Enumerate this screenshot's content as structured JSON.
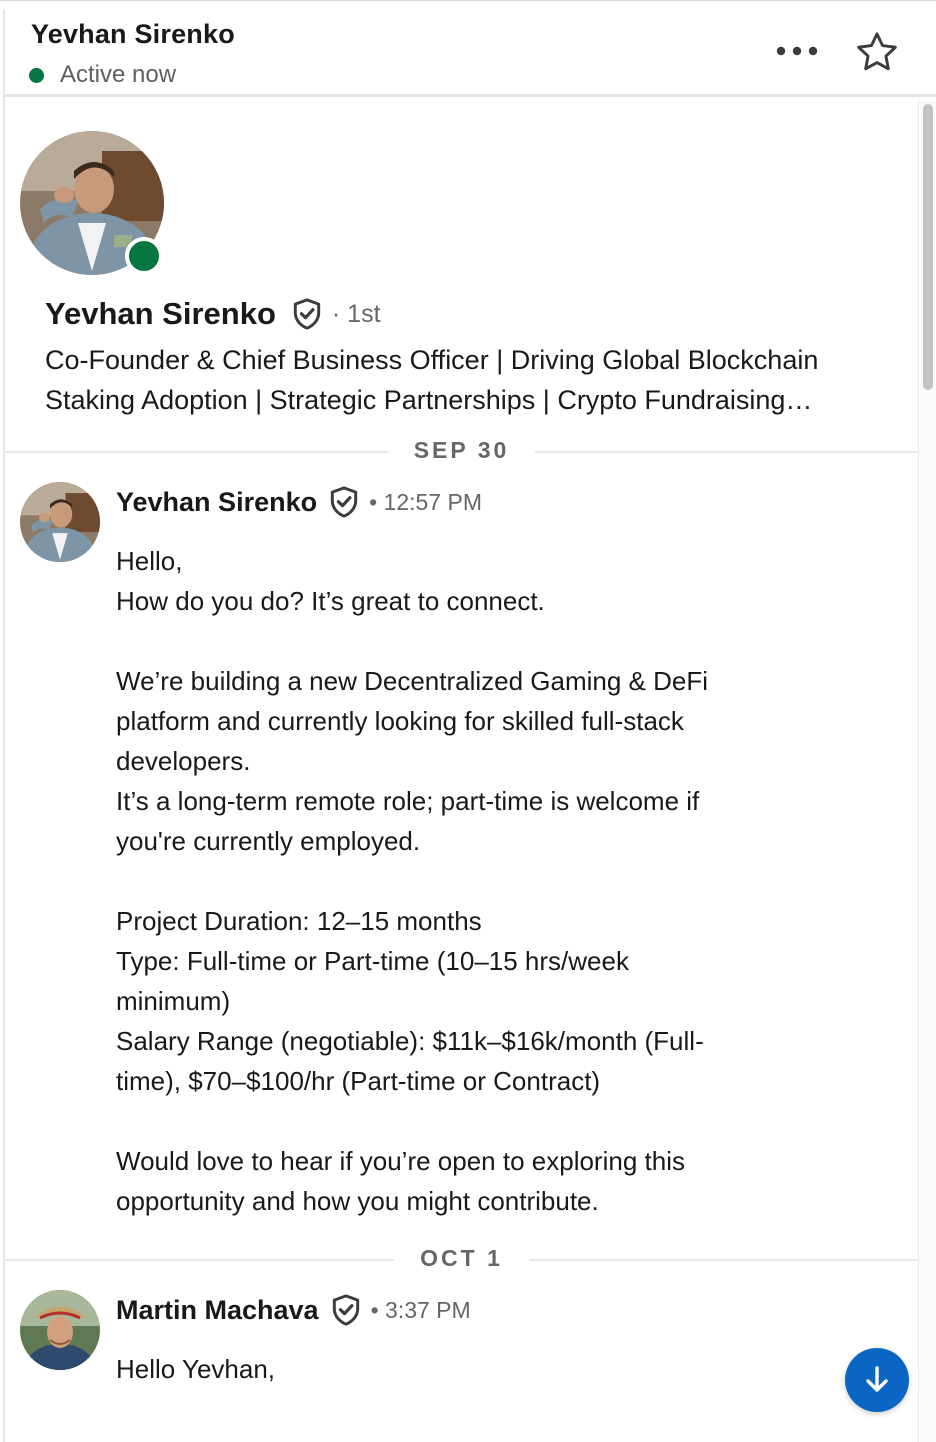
{
  "header": {
    "name": "Yevhan Sirenko",
    "status": "Active now",
    "more_icon": "more-horizontal-icon",
    "star_icon": "star-outline-icon"
  },
  "profile": {
    "name": "Yevhan Sirenko",
    "degree": "· 1st",
    "headline_line1": "Co-Founder & Chief Business Officer | Driving Global Blockchain",
    "headline_line2": "Staking Adoption | Strategic Partnerships | Crypto Fundraising…",
    "online_color": "#057642"
  },
  "dividers": [
    {
      "label": "SEP 30"
    },
    {
      "label": "OCT 1"
    }
  ],
  "messages": [
    {
      "sender": "Yevhan Sirenko",
      "time": "• 12:57 PM",
      "lines": [
        "Hello,",
        "How do you do? It’s great to connect.",
        "",
        "We’re building a new Decentralized Gaming & DeFi",
        "platform and currently looking for skilled full-stack",
        "developers.",
        "It’s a long-term remote role; part-time is welcome if",
        "you're currently employed.",
        "",
        "Project Duration: 12–15 months",
        "Type: Full-time or Part-time (10–15 hrs/week",
        "minimum)",
        "Salary Range (negotiable): $11k–$16k/month (Full-",
        "time), $70–$100/hr (Part-time or Contract)",
        "",
        "Would love to hear if you’re open to exploring this",
        "opportunity and how you might contribute."
      ]
    },
    {
      "sender": "Martin Machava",
      "time": "• 3:37 PM",
      "lines": [
        "Hello Yevhan,"
      ]
    }
  ],
  "colors": {
    "accent": "#0a66c2",
    "online": "#057642",
    "text": "#191919",
    "muted": "#666666"
  }
}
